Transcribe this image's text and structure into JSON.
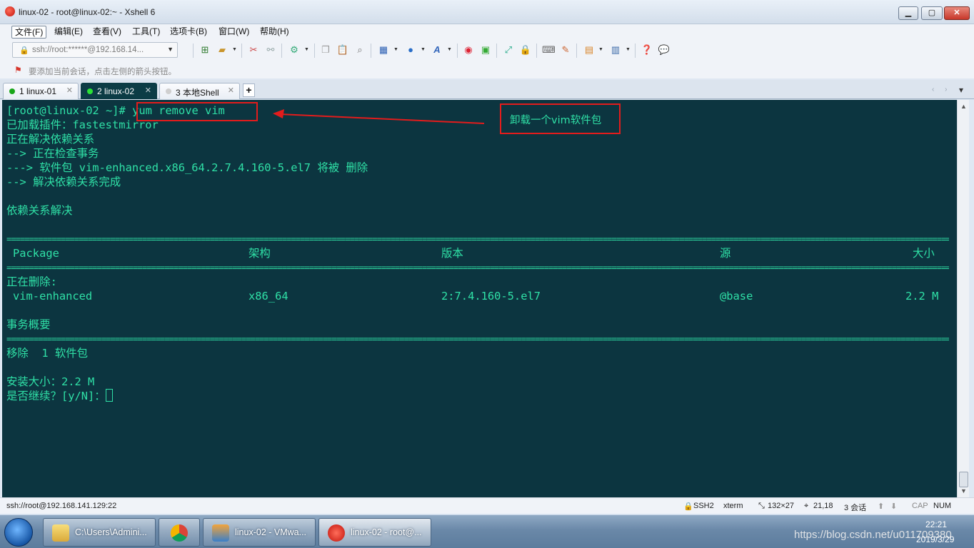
{
  "window": {
    "title": "linux-02 - root@linux-02:~ - Xshell 6",
    "minimize": "▁",
    "maximize": "▢",
    "close": "✕"
  },
  "menu": [
    "文件(F)",
    "编辑(E)",
    "查看(V)",
    "工具(T)",
    "选项卡(B)",
    "窗口(W)",
    "帮助(H)"
  ],
  "toolbar": {
    "session_address": "ssh://root:******@192.168.14...",
    "lock_icon": "lock-icon",
    "dropdown_arrow": "▼"
  },
  "hint": {
    "text": "要添加当前会话，点击左侧的箭头按钮。",
    "icon": "bookmark-arrow-icon"
  },
  "tabs": [
    {
      "label": "1 linux-01",
      "status_color": "#19a619",
      "active": false
    },
    {
      "label": "2 linux-02",
      "status_color": "#2be236",
      "active": true
    },
    {
      "label": "3 本地Shell",
      "status_color": "#cfcfcf",
      "active": false
    }
  ],
  "tab_add": "+",
  "tab_nav": "‹ ›",
  "tab_menu": "▾",
  "terminal": {
    "prompt": "[root@linux-02 ~]# ",
    "command": "yum remove vim",
    "lines": [
      "已加载插件：fastestmirror",
      "正在解决依赖关系",
      "--> 正在检查事务",
      "---> 软件包 vim-enhanced.x86_64.2.7.4.160-5.el7 将被 删除",
      "--> 解决依赖关系完成",
      "依赖关系解决"
    ],
    "table_headers": [
      "Package",
      "架构",
      "版本",
      "源",
      "大小"
    ],
    "removing_label": "正在删除:",
    "table_row": [
      "vim-enhanced",
      "x86_64",
      "2:7.4.160-5.el7",
      "@base",
      "2.2 M"
    ],
    "summary_label": "事务概要",
    "summary_line": "移除  1 软件包",
    "install_size": "安装大小：2.2 M",
    "confirm_prompt": "是否继续？[y/N]："
  },
  "annotation": {
    "note": "卸载一个vim软件包",
    "color": "#e31c1c"
  },
  "colors": {
    "terminal_bg": "#0c3540",
    "terminal_fg": "#2fe0a6"
  },
  "status": {
    "connection": "ssh://root@192.168.141.129:22",
    "protocol": "SSH2",
    "term_type": "xterm",
    "size": "132×27",
    "cursor_pos": "21,18",
    "sessions": "3 会话",
    "cap": "CAP",
    "num": "NUM"
  },
  "taskbar": {
    "items": [
      {
        "label": "C:\\Users\\Admini...",
        "icon": "folder-icon",
        "active": false
      },
      {
        "label": "",
        "icon": "chrome-icon",
        "active": false
      },
      {
        "label": "linux-02 - VMwa...",
        "icon": "vmware-icon",
        "active": false
      },
      {
        "label": "linux-02 - root@...",
        "icon": "xshell-icon",
        "active": true
      }
    ],
    "watermark": "https://blog.csdn.net/u011709380",
    "clock_time": "22:21",
    "clock_date": "2019/3/29"
  }
}
